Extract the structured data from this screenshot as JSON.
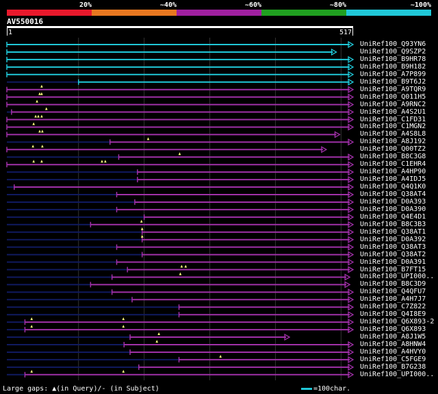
{
  "identity_bar": {
    "segments": [
      {
        "label": "20%",
        "color": "#e8192c"
      },
      {
        "label": "~40%",
        "color": "#e87820"
      },
      {
        "label": "~60%",
        "color": "#a020a0"
      },
      {
        "label": "~80%",
        "color": "#20a020"
      },
      {
        "label": "~100%",
        "color": "#20c8d8"
      }
    ]
  },
  "query": {
    "name": "AV550016",
    "start": "1",
    "end": "517",
    "length": 517
  },
  "colors": {
    "cyan": "#20c8d8",
    "magenta": "#a030a8",
    "navy": "#101a60",
    "gap": "#ffff80",
    "grid": "#333333"
  },
  "hits": [
    {
      "label": "UniRef100_Q93YN6",
      "c": "cyan",
      "s": 1,
      "e": 517,
      "arrow": 1,
      "gaps": []
    },
    {
      "label": "UniRef100_Q9SZP2",
      "c": "cyan",
      "s": 1,
      "e": 492,
      "arrow": 1,
      "gaps": []
    },
    {
      "label": "UniRef100_B9HR78",
      "c": "cyan",
      "s": 1,
      "e": 517,
      "arrow": 1,
      "gaps": []
    },
    {
      "label": "UniRef100_B9H182",
      "c": "cyan",
      "s": 1,
      "e": 517,
      "arrow": 1,
      "gaps": []
    },
    {
      "label": "UniRef100_A7P899",
      "c": "cyan",
      "s": 1,
      "e": 517,
      "arrow": 1,
      "gaps": []
    },
    {
      "label": "UniRef100_B9T6J2",
      "c": "cyan",
      "s": 108,
      "e": 517,
      "arrow": 1,
      "gaps": []
    },
    {
      "label": "UniRef100_A9TQR9",
      "c": "magenta",
      "s": 1,
      "e": 517,
      "arrow": 1,
      "gaps": [
        53
      ]
    },
    {
      "label": "UniRef100_Q011H5",
      "c": "magenta",
      "s": 1,
      "e": 517,
      "arrow": 1,
      "gaps": [
        50,
        53
      ]
    },
    {
      "label": "UniRef100_A9RNC2",
      "c": "magenta",
      "s": 1,
      "e": 517,
      "arrow": 1,
      "gaps": [
        46
      ]
    },
    {
      "label": "UniRef100_A4S2U1",
      "c": "magenta",
      "s": 8,
      "e": 517,
      "arrow": 1,
      "gaps": [
        60
      ]
    },
    {
      "label": "UniRef100_C1FD31",
      "c": "magenta",
      "s": 1,
      "e": 517,
      "arrow": 1,
      "gaps": [
        44,
        48,
        53
      ]
    },
    {
      "label": "UniRef100_C1MGN2",
      "c": "magenta",
      "s": 1,
      "e": 517,
      "arrow": 1,
      "gaps": [
        41
      ]
    },
    {
      "label": "UniRef100_A4S8L8",
      "c": "magenta",
      "s": 1,
      "e": 497,
      "arrow": 1,
      "gaps": [
        50,
        54
      ]
    },
    {
      "label": "UniRef100_A8J192",
      "c": "magenta",
      "s": 155,
      "e": 517,
      "arrow": 1,
      "gaps": [
        212
      ]
    },
    {
      "label": "UniRef100_Q00TZ2",
      "c": "magenta",
      "s": 1,
      "e": 477,
      "arrow": 1,
      "gaps": [
        40,
        54
      ]
    },
    {
      "label": "UniRef100_B8C3G8",
      "c": "magenta",
      "s": 168,
      "e": 517,
      "arrow": 1,
      "gaps": [
        259
      ]
    },
    {
      "label": "UniRef100_C1EHR4",
      "c": "magenta",
      "s": 1,
      "e": 517,
      "arrow": 1,
      "gaps": [
        41,
        53,
        143,
        148
      ]
    },
    {
      "label": "UniRef100_A4HP90",
      "c": "magenta",
      "s": 196,
      "e": 517,
      "arrow": 1,
      "gaps": []
    },
    {
      "label": "UniRef100_A4IDJ5",
      "c": "magenta",
      "s": 196,
      "e": 517,
      "arrow": 1,
      "gaps": []
    },
    {
      "label": "UniRef100_Q4Q1K0",
      "c": "magenta",
      "s": 12,
      "e": 517,
      "arrow": 1,
      "gaps": []
    },
    {
      "label": "UniRef100_Q38AT4",
      "c": "magenta",
      "s": 165,
      "e": 517,
      "arrow": 1,
      "gaps": []
    },
    {
      "label": "UniRef100_D0A393",
      "c": "magenta",
      "s": 192,
      "e": 517,
      "arrow": 1,
      "gaps": []
    },
    {
      "label": "UniRef100_D0A390",
      "c": "magenta",
      "s": 165,
      "e": 517,
      "arrow": 1,
      "gaps": []
    },
    {
      "label": "UniRef100_Q4E4D1",
      "c": "magenta",
      "s": 206,
      "e": 517,
      "arrow": 1,
      "gaps": []
    },
    {
      "label": "UniRef100_B8C3B3",
      "c": "magenta",
      "s": 126,
      "e": 517,
      "arrow": 1,
      "gaps": [
        202
      ]
    },
    {
      "label": "UniRef100_Q38AT1",
      "c": "magenta",
      "s": 203,
      "e": 517,
      "arrow": 1,
      "gaps": [
        203
      ]
    },
    {
      "label": "UniRef100_D0A392",
      "c": "magenta",
      "s": 203,
      "e": 517,
      "arrow": 1,
      "gaps": [
        203
      ]
    },
    {
      "label": "UniRef100_Q38AT3",
      "c": "magenta",
      "s": 165,
      "e": 517,
      "arrow": 1,
      "gaps": []
    },
    {
      "label": "UniRef100_Q38AT2",
      "c": "magenta",
      "s": 203,
      "e": 517,
      "arrow": 1,
      "gaps": []
    },
    {
      "label": "UniRef100_D0A391",
      "c": "magenta",
      "s": 165,
      "e": 517,
      "arrow": 1,
      "gaps": []
    },
    {
      "label": "UniRef100_B7FT15",
      "c": "magenta",
      "s": 181,
      "e": 517,
      "arrow": 1,
      "gaps": [
        262,
        268
      ]
    },
    {
      "label": "UniRef100_UPI000..",
      "c": "magenta",
      "s": 158,
      "e": 512,
      "arrow": 1,
      "gaps": [
        260
      ]
    },
    {
      "label": "UniRef100_B8C3D9",
      "c": "magenta",
      "s": 126,
      "e": 512,
      "arrow": 1,
      "gaps": []
    },
    {
      "label": "UniRef100_Q4QFU7",
      "c": "magenta",
      "s": 158,
      "e": 517,
      "arrow": 1,
      "gaps": []
    },
    {
      "label": "UniRef100_A4H7J7",
      "c": "magenta",
      "s": 188,
      "e": 517,
      "arrow": 1,
      "gaps": []
    },
    {
      "label": "UniRef100_C7Z822",
      "c": "magenta",
      "s": 258,
      "e": 517,
      "arrow": 1,
      "gaps": []
    },
    {
      "label": "UniRef100_Q4I8E9",
      "c": "magenta",
      "s": 258,
      "e": 517,
      "arrow": 1,
      "gaps": []
    },
    {
      "label": "UniRef100_Q6X893-2",
      "c": "magenta",
      "s": 28,
      "e": 517,
      "arrow": 1,
      "gaps": [
        38,
        175
      ]
    },
    {
      "label": "UniRef100_Q6X893",
      "c": "magenta",
      "s": 28,
      "e": 517,
      "arrow": 1,
      "gaps": [
        38,
        175
      ]
    },
    {
      "label": "UniRef100_A8J1W5",
      "c": "magenta",
      "s": 185,
      "e": 422,
      "arrow": 1,
      "gaps": [
        228
      ]
    },
    {
      "label": "UniRef100_A8HNW4",
      "c": "magenta",
      "s": 176,
      "e": 517,
      "arrow": 1,
      "gaps": [
        225
      ]
    },
    {
      "label": "UniRef100_A4HVY0",
      "c": "magenta",
      "s": 185,
      "e": 517,
      "arrow": 1,
      "gaps": []
    },
    {
      "label": "UniRef100_C5FGE9",
      "c": "magenta",
      "s": 258,
      "e": 517,
      "arrow": 1,
      "gaps": [
        320
      ]
    },
    {
      "label": "UniRef100_B7G238",
      "c": "magenta",
      "s": 198,
      "e": 517,
      "arrow": 1,
      "gaps": []
    },
    {
      "label": "UniRef100_UPI000..",
      "c": "magenta",
      "s": 28,
      "e": 517,
      "arrow": 1,
      "gaps": [
        38,
        175
      ]
    }
  ],
  "legend": {
    "text": "Large gaps: ▲(in Query)/- (in Subject)",
    "scale": "=100char."
  }
}
